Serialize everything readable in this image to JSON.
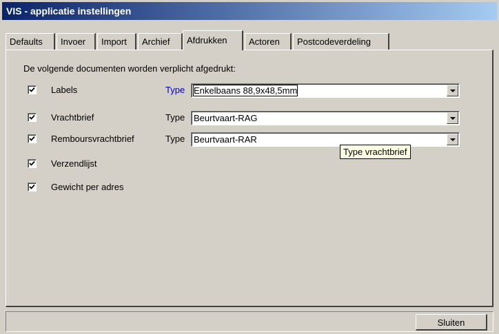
{
  "window": {
    "title": "VIS - applicatie instellingen"
  },
  "tabs": [
    {
      "label": "Defaults"
    },
    {
      "label": "Invoer"
    },
    {
      "label": "Import"
    },
    {
      "label": "Archief"
    },
    {
      "label": "Afdrukken",
      "active": true
    },
    {
      "label": "Actoren"
    },
    {
      "label": "Postcodeverdeling"
    }
  ],
  "panel": {
    "intro": "De volgende documenten worden verplicht afgedrukt:",
    "type_label": "Type",
    "items": [
      {
        "label": "Labels",
        "checked": true,
        "type_value": "Enkelbaans 88,9x48,5mm"
      },
      {
        "label": "Vrachtbrief",
        "checked": true,
        "type_value": "Beurtvaart-RAG"
      },
      {
        "label": "Remboursvrachtbrief",
        "checked": true,
        "type_value": "Beurtvaart-RAR"
      },
      {
        "label": "Verzendlijst",
        "checked": true
      },
      {
        "label": "Gewicht per adres",
        "checked": true
      }
    ]
  },
  "tooltip": "Type vrachtbrief",
  "footer": {
    "close_label": "Sluiten"
  },
  "colors": {
    "titlebar_start": "#0a246a",
    "titlebar_end": "#a6caf0",
    "face": "#d4d0c8",
    "tooltip_bg": "#ffffe1",
    "focus_type_label": "#0000c0"
  }
}
